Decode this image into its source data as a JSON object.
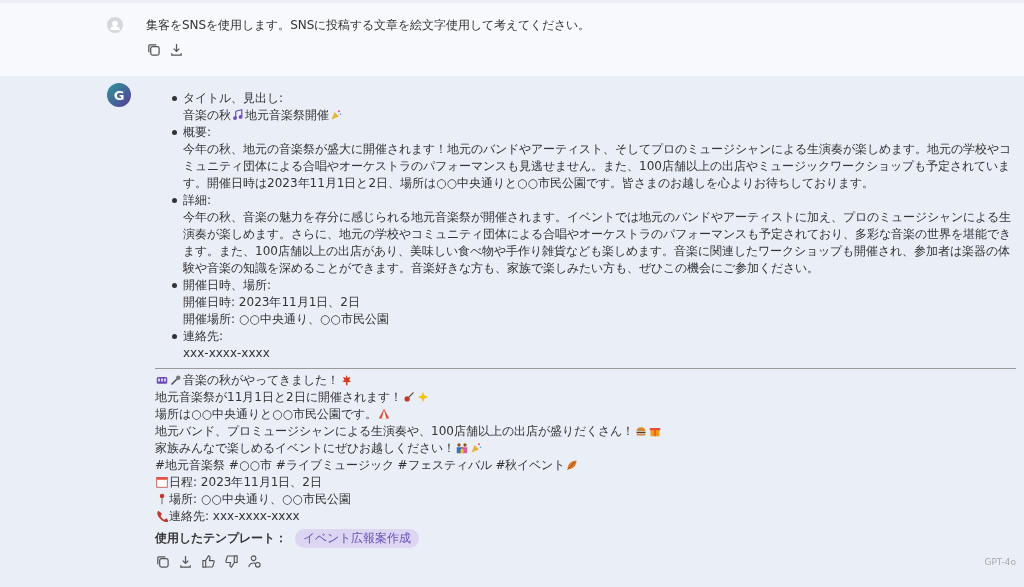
{
  "user_message": {
    "text": "集客をSNSを使用します。SNSに投稿する文章を絵文字使用して考えてください。"
  },
  "assistant_message": {
    "avatar_letter": "G",
    "outline": [
      {
        "label": "タイトル、見出し:",
        "lines": [
          [
            {
              "kind": "text",
              "text": "音楽の秋"
            },
            {
              "kind": "icon"
            },
            {
              "kind": "text",
              "text": "地元音楽祭開催"
            },
            {
              "kind": "icon"
            }
          ]
        ]
      },
      {
        "label": "概要:",
        "lines": [
          [
            {
              "kind": "text",
              "text": "今年の秋、地元の音楽祭が盛大に開催されます！地元のバンドやアーティスト、そしてプロのミュージシャンによる生演奏が楽しめます。地元の学校やコミュニティ団体による合唱やオーケストラのパフォーマンスも見逃せません。また、100店舗以上の出店やミュージックワークショップも予定されています。開催日時は2023年11月1日と2日、場所は○○中央通りと○○市民公園です。皆さまのお越しを心よりお待ちしております。"
            }
          ]
        ]
      },
      {
        "label": "詳細:",
        "lines": [
          [
            {
              "kind": "text",
              "text": "今年の秋、音楽の魅力を存分に感じられる地元音楽祭が開催されます。イベントでは地元のバンドやアーティストに加え、プロのミュージシャンによる生演奏が楽しめます。さらに、地元の学校やコミュニティ団体による合唱やオーケストラのパフォーマンスも予定されており、多彩な音楽の世界を堪能できます。また、100店舗以上の出店があり、美味しい食べ物や手作り雑貨なども楽しめます。音楽に関連したワークショップも開催され、参加者は楽器の体験や音楽の知識を深めることができます。音楽好きな方も、家族で楽しみたい方も、ぜひこの機会にご参加ください。"
            }
          ]
        ]
      },
      {
        "label": "開催日時、場所:",
        "lines": [
          [
            {
              "kind": "text",
              "text": "開催日時: 2023年11月1日、2日"
            }
          ],
          [
            {
              "kind": "text",
              "text": "開催場所: ○○中央通り、○○市民公園"
            }
          ]
        ]
      },
      {
        "label": "連絡先:",
        "lines": [
          [
            {
              "kind": "text",
              "text": "xxx-xxxx-xxxx"
            }
          ]
        ]
      }
    ],
    "post_lines": [
      [
        {
          "kind": "icon"
        },
        {
          "kind": "icon"
        },
        {
          "kind": "text",
          "text": "音楽の秋がやってきました！"
        },
        {
          "kind": "icon"
        }
      ],
      [
        {
          "kind": "text",
          "text": "地元音楽祭が11月1日と2日に開催されます！"
        },
        {
          "kind": "icon"
        },
        {
          "kind": "icon"
        }
      ],
      [
        {
          "kind": "text",
          "text": "場所は○○中央通りと○○市民公園です。"
        },
        {
          "kind": "icon"
        }
      ],
      [
        {
          "kind": "text",
          "text": "地元バンド、プロミュージシャンによる生演奏や、100店舗以上の出店が盛りだくさん！"
        },
        {
          "kind": "icon"
        },
        {
          "kind": "icon"
        }
      ],
      [
        {
          "kind": "text",
          "text": "家族みんなで楽しめるイベントにぜひお越しください！"
        },
        {
          "kind": "icon"
        },
        {
          "kind": "icon"
        }
      ],
      [
        {
          "kind": "text",
          "text": "#地元音楽祭 #○○市 #ライブミュージック #フェスティバル #秋イベント"
        },
        {
          "kind": "icon"
        }
      ],
      [
        {
          "kind": "icon"
        },
        {
          "kind": "text",
          "text": "日程: 2023年11月1日、2日"
        }
      ],
      [
        {
          "kind": "icon"
        },
        {
          "kind": "text",
          "text": "場所: ○○中央通り、○○市民公園"
        }
      ],
      [
        {
          "kind": "icon"
        },
        {
          "kind": "text",
          "text": "連絡先: xxx-xxxx-xxxx"
        }
      ]
    ],
    "template_label": "使用したテンプレート：",
    "template_tag": "イベント広報案作成",
    "model": "GPT-4o"
  }
}
